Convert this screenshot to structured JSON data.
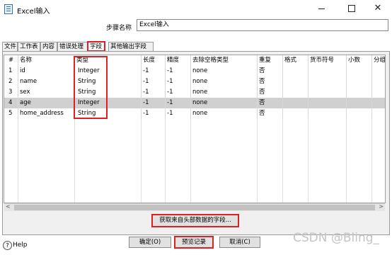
{
  "window": {
    "title": "Excel输入",
    "minimize": "",
    "maximize": "",
    "close": "✕"
  },
  "step": {
    "label": "步骤名称",
    "value": "Excel输入"
  },
  "tabs": [
    {
      "label": "文件"
    },
    {
      "label": "工作表"
    },
    {
      "label": "内容"
    },
    {
      "label": "错误处理"
    },
    {
      "label": "字段",
      "active": true
    },
    {
      "label": "其他输出字段"
    }
  ],
  "table": {
    "columns": [
      "#",
      "名称",
      "类型",
      "长度",
      "精度",
      "去除空格类型",
      "重复",
      "格式",
      "货币符号",
      "小数",
      "分组"
    ],
    "rows": [
      [
        "1",
        "id",
        "Integer",
        "-1",
        "-1",
        "none",
        "否"
      ],
      [
        "2",
        "name",
        "String",
        "-1",
        "-1",
        "none",
        "否"
      ],
      [
        "3",
        "sex",
        "String",
        "-1",
        "-1",
        "none",
        "否"
      ],
      [
        "4",
        "age",
        "Integer",
        "-1",
        "-1",
        "none",
        "否"
      ],
      [
        "5",
        "home_address",
        "String",
        "-1",
        "-1",
        "none",
        "否"
      ]
    ],
    "selected_row": 3
  },
  "scrollbar": {
    "left_arrow": "<",
    "right_arrow": ">"
  },
  "buttons": {
    "get_fields": "获取来自头部数据的字段...",
    "ok": "确定(O)",
    "preview": "预览记录",
    "cancel": "取消(C)"
  },
  "help": {
    "label": "Help",
    "icon_text": "?"
  },
  "watermark": "CSDN @Bling_"
}
